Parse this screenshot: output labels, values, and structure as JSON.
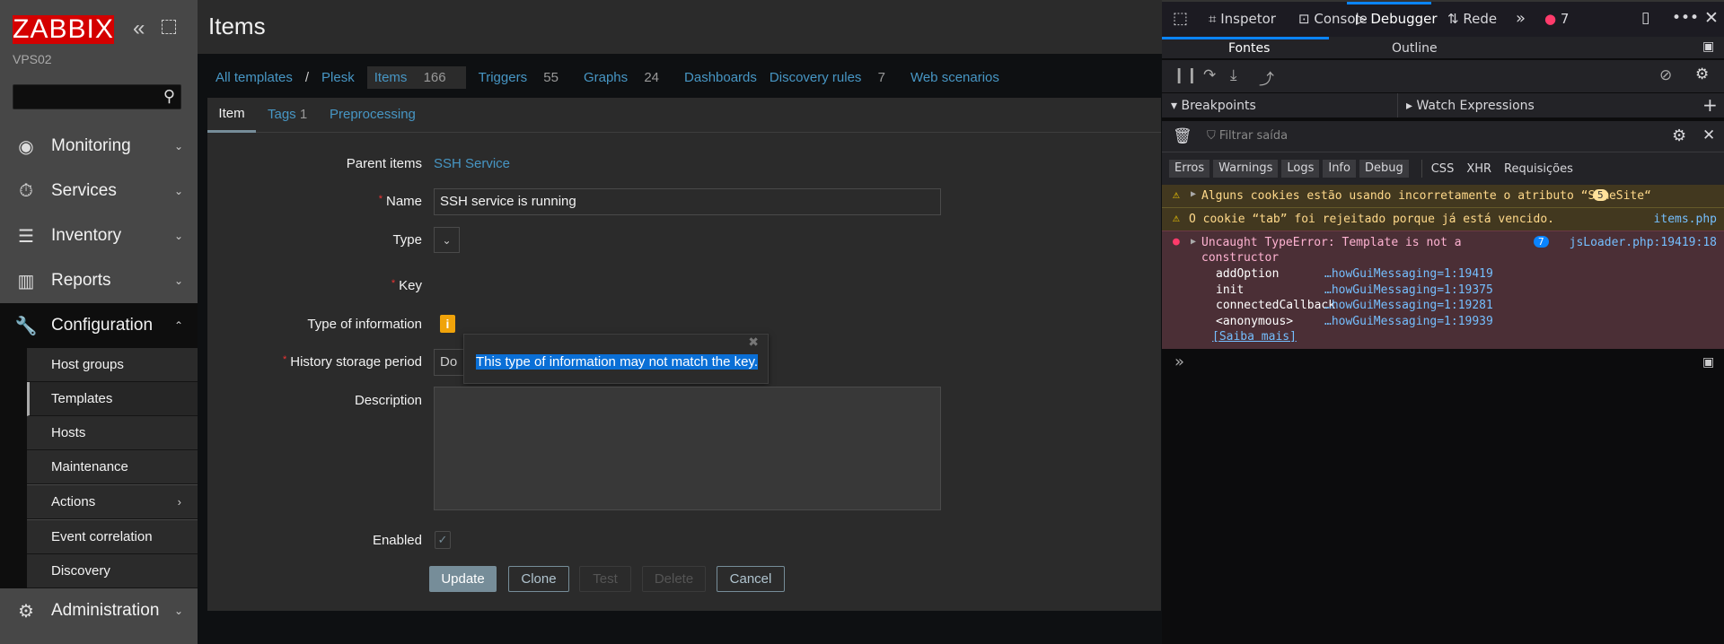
{
  "sidebar": {
    "logo": "ZABBIX",
    "server": "VPS02",
    "collapse": "«",
    "kiosk": "⤡",
    "menu": [
      {
        "label": "Monitoring"
      },
      {
        "label": "Services"
      },
      {
        "label": "Inventory"
      },
      {
        "label": "Reports"
      },
      {
        "label": "Configuration"
      },
      {
        "label": "Administration"
      }
    ],
    "submenu": [
      "Host groups",
      "Templates",
      "Hosts",
      "Maintenance",
      "Actions",
      "Event correlation",
      "Discovery"
    ]
  },
  "header": {
    "title": "Items"
  },
  "breadcrumb": {
    "all": "All templates",
    "sep": "/",
    "template": "Plesk"
  },
  "navtabs": [
    {
      "label": "Items",
      "count": "166"
    },
    {
      "label": "Triggers",
      "count": "55"
    },
    {
      "label": "Graphs",
      "count": "24"
    },
    {
      "label": "Dashboards",
      "count": ""
    },
    {
      "label": "Discovery rules",
      "count": "7"
    },
    {
      "label": "Web scenarios",
      "count": ""
    }
  ],
  "formtabs": [
    {
      "label": "Item"
    },
    {
      "label": "Tags",
      "count": "1"
    },
    {
      "label": "Preprocessing"
    }
  ],
  "form": {
    "parent_label": "Parent items",
    "parent_value": "SSH Service",
    "name_label": "Name",
    "name_value": "SSH service is running",
    "type_label": "Type",
    "key_label": "Key",
    "typeinfo_label": "Type of information",
    "history_label": "History storage period",
    "history_value": "Do",
    "description_label": "Description",
    "enabled_label": "Enabled",
    "tooltip": "This type of information may not match the key."
  },
  "buttons": {
    "update": "Update",
    "clone": "Clone",
    "test": "Test",
    "delete": "Delete",
    "cancel": "Cancel"
  },
  "devtools": {
    "tabs": [
      "Inspetor",
      "Console",
      "Debugger",
      "Rede"
    ],
    "error_count": "7",
    "subtabs": [
      "Fontes",
      "Outline"
    ],
    "breakpoints": "Breakpoints",
    "watch": "Watch Expressions",
    "filter_placeholder": "Filtrar saída",
    "filters": [
      "Erros",
      "Warnings",
      "Logs",
      "Info",
      "Debug"
    ],
    "filters2": [
      "CSS",
      "XHR",
      "Requisições"
    ],
    "messages": [
      {
        "text": "Alguns cookies estão usando incorretamente o atributo “SameSite“",
        "count": "5"
      },
      {
        "text": "O cookie “tab” foi rejeitado porque já está vencido.",
        "source": "items.php"
      }
    ],
    "error": {
      "text": "Uncaught TypeError: Template is not a",
      "text2": "constructor",
      "count": "7",
      "source": "jsLoader.php:19419:18",
      "stack": [
        {
          "fn": "addOption",
          "loc": "…howGuiMessaging=1:19419"
        },
        {
          "fn": "init",
          "loc": "…howGuiMessaging=1:19375"
        },
        {
          "fn": "connectedCallback",
          "loc": "…howGuiMessaging=1:19281"
        },
        {
          "fn": "<anonymous>",
          "loc": "…howGuiMessaging=1:19939"
        }
      ],
      "learn": "[Saiba mais]"
    },
    "prompt": "»"
  }
}
